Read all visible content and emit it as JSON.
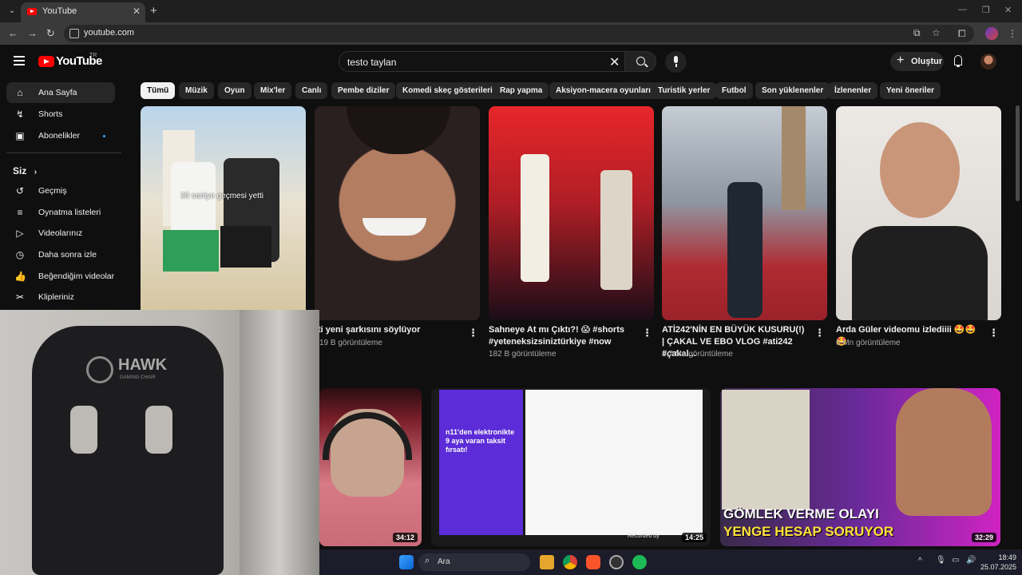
{
  "browser": {
    "tab_title": "YouTube",
    "url": "youtube.com"
  },
  "header": {
    "logo_text": "YouTube",
    "country_code": "TR",
    "search_value": "testo taylan",
    "create_label": "Oluştur"
  },
  "sidebar": {
    "items": [
      {
        "label": "Ana Sayfa",
        "icon": "home-icon"
      },
      {
        "label": "Shorts",
        "icon": "shorts-icon"
      },
      {
        "label": "Abonelikler",
        "icon": "subscriptions-icon"
      }
    ],
    "you_section": "Siz",
    "you_items": [
      {
        "label": "Geçmiş",
        "icon": "history-icon"
      },
      {
        "label": "Oynatma listeleri",
        "icon": "playlists-icon"
      },
      {
        "label": "Videolarınız",
        "icon": "your-videos-icon"
      },
      {
        "label": "Daha sonra izle",
        "icon": "watch-later-icon"
      },
      {
        "label": "Beğendiğim videolar",
        "icon": "liked-videos-icon"
      },
      {
        "label": "Klipleriniz",
        "icon": "clips-icon"
      }
    ]
  },
  "chips": [
    "Tümü",
    "Müzik",
    "Oyun",
    "Mix'ler",
    "Canlı",
    "Pembe diziler",
    "Komedi skeç gösterileri",
    "Rap yapma",
    "Aksiyon-macera oyunları",
    "Turistik yerler",
    "Futbol",
    "Son yüklenenler",
    "İzlenenler",
    "Yeni öneriler"
  ],
  "shorts": [
    {
      "overlay": "30 saniye geçmesi yetti",
      "title": "",
      "views": ""
    },
    {
      "title": "ti yeni şarkısını söylüyor",
      "views": "19 B görüntüleme"
    },
    {
      "title": "Sahneye At mı Çıktı?! 😱 #shorts #yeteneksizsiniztürkiye #now",
      "views": "182 B görüntüleme"
    },
    {
      "title": "ATİ242'NİN EN BÜYÜK KUSURU(!) | ÇAKAL VE EBO VLOG #ati242 #çakal...",
      "views": "1,7 Mn görüntüleme"
    },
    {
      "title": "Arda Güler videomu izlediiii 🤩🤩🤩",
      "views": "6 Mn görüntüleme"
    }
  ],
  "videos": [
    {
      "duration": "34:12"
    },
    {
      "duration": "14:25",
      "thumb_text": "n11'den elektronikte 9 aya varan taksit fırsatı!",
      "recorded": "Recorded by"
    },
    {
      "duration": "32:29",
      "thumb_line1": "GÖMLEK VERME OLAYI",
      "thumb_line2": "YENGE HESAP SORUYOR"
    }
  ],
  "webcam": {
    "chair_brand": "HAWK",
    "chair_sub": "GAMING CHAIR"
  },
  "taskbar": {
    "search_label": "Ara",
    "time": "18:49",
    "date": "25.07.2025"
  },
  "colors": {
    "bg": "#0f0f0f",
    "chip": "#272727",
    "brand": "#ff0000",
    "accent": "#3ea6ff"
  }
}
